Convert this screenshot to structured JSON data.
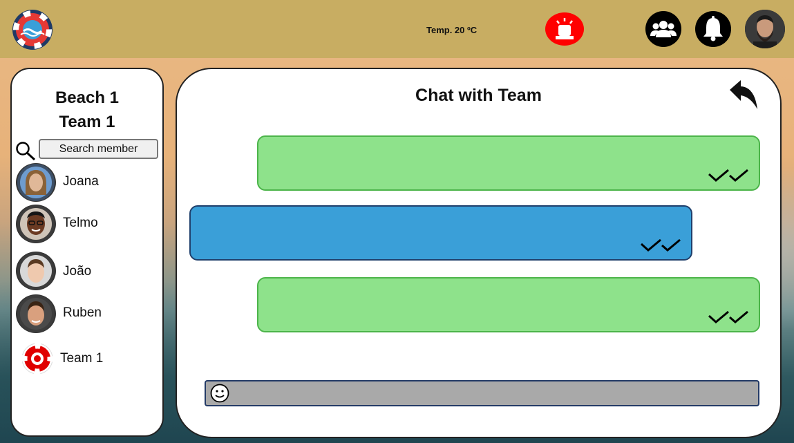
{
  "header": {
    "temperature": "Temp. 20 ºC",
    "alarm_icon": "siren-icon",
    "team_icon": "team-icon",
    "bell_icon": "bell-icon",
    "colors": {
      "bar": "#c8ad62",
      "alarm": "#ff0000"
    }
  },
  "sidebar": {
    "beach": "Beach 1",
    "team": "Team 1",
    "search_placeholder": "Search member",
    "members": [
      {
        "name": "Joana"
      },
      {
        "name": "Telmo"
      },
      {
        "name": "João"
      },
      {
        "name": "Ruben"
      },
      {
        "name": "Team 1"
      }
    ]
  },
  "chat": {
    "title": "Chat with Team",
    "messages": [
      {
        "direction": "sent",
        "text": "",
        "status": "read"
      },
      {
        "direction": "received",
        "text": "",
        "status": "read"
      },
      {
        "direction": "sent",
        "text": "",
        "status": "read"
      }
    ],
    "input_value": "",
    "colors": {
      "sent": "#8ee28b",
      "received": "#3a9fd8"
    }
  }
}
